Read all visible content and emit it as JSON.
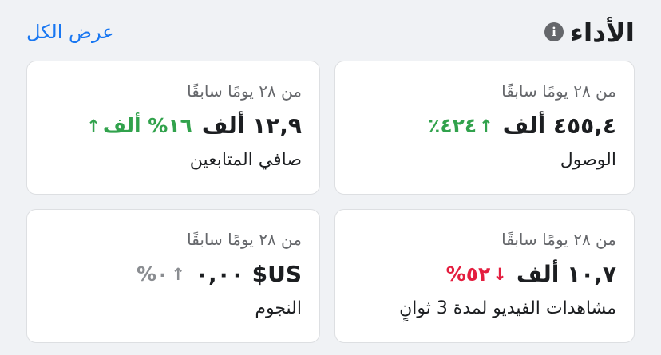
{
  "header": {
    "title": "الأداء",
    "see_all": "عرض الكل"
  },
  "cards": {
    "reach": {
      "period": "من ٢٨ يومًا سابقًا",
      "value": "٤٥٥,٤ ألف",
      "delta": "٤٢٤٪",
      "direction": "up",
      "label": "الوصول"
    },
    "net_followers": {
      "period": "من ٢٨ يومًا سابقًا",
      "value": "١٢,٩ ألف",
      "delta": "١٦% ألف",
      "direction": "up",
      "label": "صافي المتابعين"
    },
    "video_views": {
      "period": "من ٢٨ يومًا سابقًا",
      "value": "١٠,٧ ألف",
      "delta": "٥٢%",
      "direction": "down",
      "label": "مشاهدات الفيديو لمدة 3 ثوانٍ"
    },
    "stars": {
      "period": "من ٢٨ يومًا سابقًا",
      "value": "US$ ٠,٠٠",
      "delta": "٠%",
      "direction": "flat",
      "label": "النجوم"
    }
  },
  "icons": {
    "info": "info-icon",
    "up": "arrow-up-icon",
    "down": "arrow-down-icon"
  },
  "colors": {
    "up": "#31a24c",
    "down": "#e41e3f",
    "flat": "#8a8d91",
    "link": "#1877f2"
  }
}
